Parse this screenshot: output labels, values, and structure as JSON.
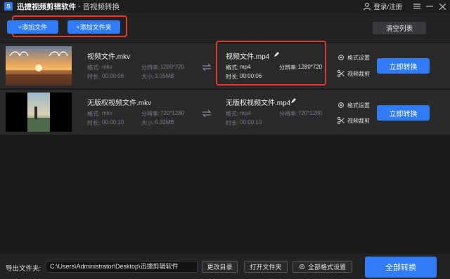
{
  "titlebar": {
    "app_name": "迅捷视频剪辑软件",
    "separator": "-",
    "module": "音视频转换",
    "login": "登录/注册",
    "logo_letter": "S"
  },
  "toolbar": {
    "add_file": "+添加文件",
    "add_folder": "+添加文件夹",
    "clear_list": "清空列表"
  },
  "files": [
    {
      "src_name": "视频文件.mkv",
      "src_format_label": "格式:",
      "src_format": "mkv",
      "src_res_label": "分辨率:",
      "src_res": "1280*720",
      "src_dur_label": "时长:",
      "src_dur": "00:00:06",
      "src_size_label": "大小:",
      "src_size": "3.05MB",
      "dst_name": "视频文件.mp4",
      "dst_format_label": "格式:",
      "dst_format": "mp4",
      "dst_res_label": "分辨率:",
      "dst_res": "1280*720",
      "dst_dur_label": "时长:",
      "dst_dur": "00:00:06",
      "format_settings": "格式设置",
      "video_crop": "视频裁剪",
      "convert_now": "立即转换"
    },
    {
      "src_name": "无版权视频文件.mkv",
      "src_format_label": "格式:",
      "src_format": "mkv",
      "src_res_label": "分辨率:",
      "src_res": "720*1280",
      "src_dur_label": "时长:",
      "src_dur": "00:00:10",
      "src_size_label": "大小:",
      "src_size": "6.32MB",
      "dst_name": "无版权视频文件.mp4",
      "dst_format_label": "格式:",
      "dst_format": "mp4",
      "dst_res_label": "分辨率:",
      "dst_res": "720*1280",
      "dst_dur_label": "时长:",
      "dst_dur": "00:00:10",
      "format_settings": "格式设置",
      "video_crop": "视频裁剪",
      "convert_now": "立即转换"
    }
  ],
  "bottom": {
    "output_label": "导出文件夹:",
    "output_path": "C:\\Users\\Administrator\\Desktop\\迅捷剪辑软件",
    "change_dir": "更改目录",
    "open_folder": "打开文件夹",
    "all_format": "全部格式设置",
    "all_convert": "全部转换"
  },
  "colors": {
    "accent": "#2f7cf6",
    "highlight": "#e53434",
    "background": "#1b1b1d"
  },
  "icons": [
    "app-logo-icon",
    "user-icon",
    "menu-icon",
    "minimize-icon",
    "close-icon",
    "convert-arrow-icon",
    "edit-pencil-icon",
    "gear-icon",
    "scissors-icon"
  ]
}
